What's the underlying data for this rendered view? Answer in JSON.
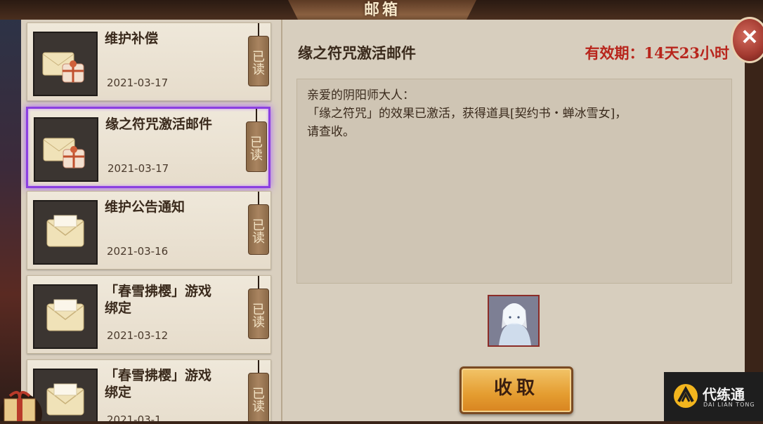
{
  "window": {
    "title": "邮箱"
  },
  "mail_list": [
    {
      "title": "维护补偿",
      "date": "2021-03-17",
      "status": "已读",
      "icon": "gift-envelope-icon",
      "selected": false
    },
    {
      "title": "缘之符咒激活邮件",
      "date": "2021-03-17",
      "status": "已读",
      "icon": "gift-envelope-icon",
      "selected": true
    },
    {
      "title": "维护公告通知",
      "date": "2021-03-16",
      "status": "已读",
      "icon": "envelope-icon",
      "selected": false
    },
    {
      "title": "「春雪拂樱」游戏\n绑定",
      "date": "2021-03-12",
      "status": "已读",
      "icon": "envelope-icon",
      "selected": false
    },
    {
      "title": "「春雪拂樱」游戏\n绑定",
      "date": "2021-03-1",
      "status": "已读",
      "icon": "envelope-icon",
      "selected": false
    }
  ],
  "detail": {
    "title": "缘之符咒激活邮件",
    "validity": "有效期：14天23小时",
    "body": "亲爱的阴阳师大人：\n「缘之符咒」的效果已激活，获得道具[契约书・蝉冰雪女]，\n请查收。",
    "reward_icon": "snow-maiden-portrait-icon",
    "collect_label": "收取"
  },
  "close_icon": "close-icon",
  "watermark": {
    "name": "代练通",
    "sub": "DAI LIAN TONG"
  },
  "colors": {
    "accent_purple": "#8b3fe0",
    "validity_red": "#b8251c",
    "button_orange": "#e49c30"
  }
}
